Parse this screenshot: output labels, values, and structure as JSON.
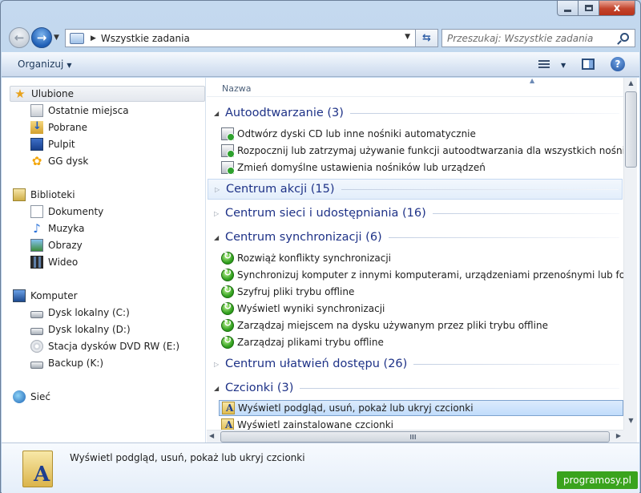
{
  "window": {
    "close_glyph": "x"
  },
  "address": {
    "path": "Wszystkie zadania",
    "search_placeholder": "Przeszukaj: Wszystkie zadania"
  },
  "toolbar": {
    "organize_label": "Organizuj"
  },
  "navigation": {
    "favorites": {
      "label": "Ulubione",
      "items": [
        "Ostatnie miejsca",
        "Pobrane",
        "Pulpit",
        "GG dysk"
      ]
    },
    "libraries": {
      "label": "Biblioteki",
      "items": [
        "Dokumenty",
        "Muzyka",
        "Obrazy",
        "Wideo"
      ]
    },
    "computer": {
      "label": "Komputer",
      "items": [
        "Dysk lokalny (C:)",
        "Dysk lokalny (D:)",
        "Stacja dysków DVD RW (E:)",
        "Backup (K:)"
      ]
    },
    "network": {
      "label": "Sieć"
    }
  },
  "file_list": {
    "column_header": "Nazwa",
    "groups": [
      {
        "title": "Autoodtwarzanie (3)",
        "expanded": true,
        "items": [
          "Odtwórz dyski CD lub inne nośniki automatycznie",
          "Rozpocznij lub zatrzymaj używanie funkcji autoodtwarzania dla wszystkich nośników i urządzeń",
          "Zmień domyślne ustawienia nośników lub urządzeń"
        ]
      },
      {
        "title": "Centrum akcji (15)",
        "expanded": false,
        "items": []
      },
      {
        "title": "Centrum sieci i udostępniania (16)",
        "expanded": false,
        "items": []
      },
      {
        "title": "Centrum synchronizacji (6)",
        "expanded": true,
        "items": [
          "Rozwiąż konflikty synchronizacji",
          "Synchronizuj komputer z innymi komputerami, urządzeniami przenośnymi lub folderami sieciowymi",
          "Szyfruj pliki trybu offline",
          "Wyświetl wyniki synchronizacji",
          "Zarządzaj miejscem na dysku używanym przez pliki trybu offline",
          "Zarządzaj plikami trybu offline"
        ]
      },
      {
        "title": "Centrum ułatwień dostępu (26)",
        "expanded": false,
        "items": []
      },
      {
        "title": "Czcionki (3)",
        "expanded": true,
        "items": [
          "Wyświetl podgląd, usuń, pokaż lub ukryj czcionki",
          "Wyświetl zainstalowane czcionki"
        ]
      }
    ]
  },
  "details": {
    "text": "Wyświetl podgląd, usuń, pokaż lub ukryj czcionki"
  },
  "watermark": "programosy.pl"
}
